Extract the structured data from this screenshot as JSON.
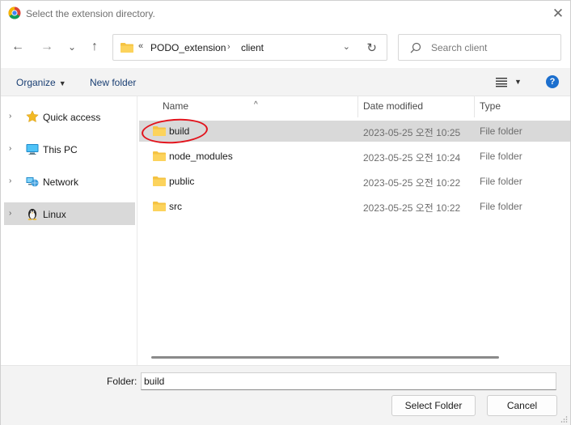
{
  "window": {
    "title": "Select the extension directory.",
    "close_glyph": "✕"
  },
  "nav": {
    "back_glyph": "←",
    "forward_glyph": "→",
    "recent_glyph": "⌄",
    "up_glyph": "↑",
    "address_overflow": "«",
    "address_segments": [
      "PODO_extension",
      "client"
    ],
    "address_separator": "›",
    "address_dropdown": "⌄",
    "refresh_glyph": "↻",
    "search_placeholder": "Search client"
  },
  "commands": {
    "organize": "Organize",
    "organize_caret": "▼",
    "new_folder": "New folder",
    "view_caret": "▼",
    "help": "?"
  },
  "sidebar": {
    "items": [
      {
        "label": "Quick access",
        "icon": "star-icon",
        "expander": "›"
      },
      {
        "label": "This PC",
        "icon": "computer-icon",
        "expander": "›"
      },
      {
        "label": "Network",
        "icon": "network-icon",
        "expander": "›"
      },
      {
        "label": "Linux",
        "icon": "linux-penguin-icon",
        "expander": "›"
      }
    ],
    "selected_index": 3
  },
  "columns": {
    "name": "Name",
    "date": "Date modified",
    "type": "Type",
    "sort_caret": "^"
  },
  "files": [
    {
      "name": "build",
      "date": "2023-05-25 오전 10:25",
      "type": "File folder"
    },
    {
      "name": "node_modules",
      "date": "2023-05-25 오전 10:24",
      "type": "File folder"
    },
    {
      "name": "public",
      "date": "2023-05-25 오전 10:22",
      "type": "File folder"
    },
    {
      "name": "src",
      "date": "2023-05-25 오전 10:22",
      "type": "File folder"
    }
  ],
  "selected_file_index": 0,
  "footer": {
    "folder_label": "Folder:",
    "folder_value": "build",
    "select_button": "Select Folder",
    "cancel_button": "Cancel"
  },
  "colors": {
    "selection": "#d9d9d9",
    "annotation_circle": "#e2121b",
    "folder": "#f5c342",
    "help_blue": "#1c6fce"
  }
}
